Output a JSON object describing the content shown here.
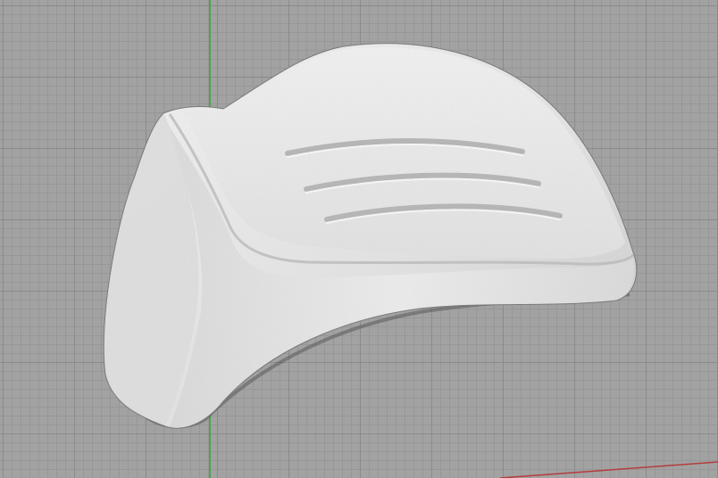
{
  "viewport": {
    "view": "perspective",
    "grid": true,
    "colors": {
      "background": "#a2a2a2",
      "grid_minor": "#979797",
      "grid_major": "#8b8b8b",
      "y_axis": "#2fa52f",
      "x_axis": "#b43c3c",
      "model": "#e6e6e6"
    }
  },
  "model": {
    "shape": "scanned armrest mesh",
    "grip_grooves": 3
  }
}
